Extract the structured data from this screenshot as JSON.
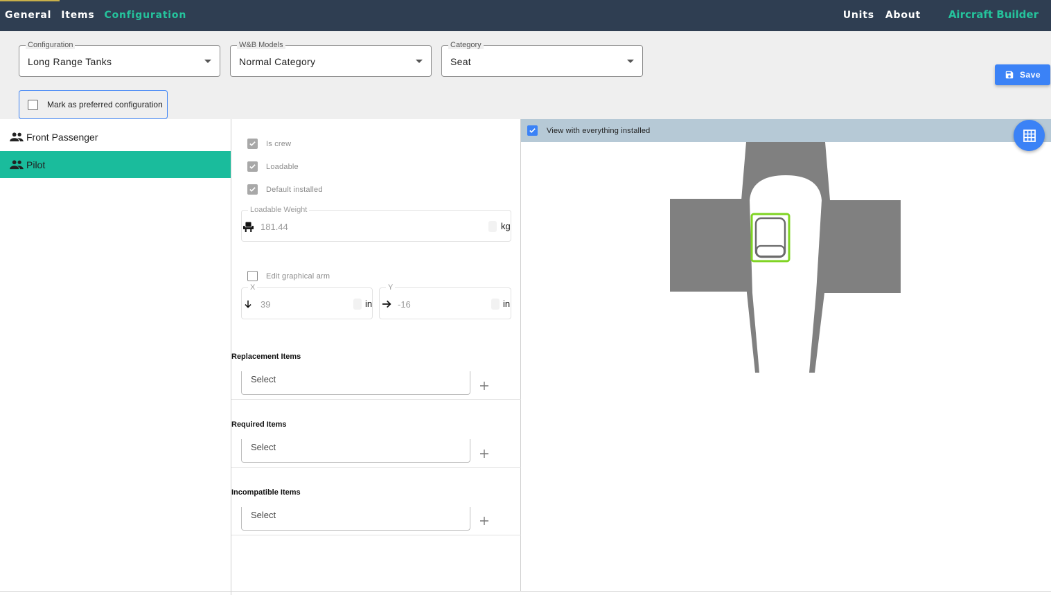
{
  "nav": {
    "left": [
      "General",
      "Items",
      "Configuration"
    ],
    "right": [
      "Units",
      "About"
    ],
    "brand": "Aircraft Builder"
  },
  "config": {
    "configuration": {
      "legend": "Configuration",
      "value": "Long Range Tanks"
    },
    "models": {
      "legend": "W&B Models",
      "value": "Normal Category"
    },
    "category": {
      "legend": "Category",
      "value": "Seat"
    },
    "preferred_label": "Mark as preferred configuration",
    "save_label": "Save"
  },
  "items": [
    {
      "label": "Front Passenger",
      "icon": "people-icon"
    },
    {
      "label": "Pilot",
      "icon": "people-icon",
      "selected": true
    }
  ],
  "form": {
    "is_crew": "Is crew",
    "loadable": "Loadable",
    "default_installed": "Default installed",
    "weight": {
      "legend": "Loadable Weight",
      "value": "181.44",
      "unit": "kg"
    },
    "edit_arm": "Edit graphical arm",
    "x": {
      "legend": "X",
      "value": "39",
      "unit": "in"
    },
    "y": {
      "legend": "Y",
      "value": "-16",
      "unit": "in"
    },
    "replacement": {
      "title": "Replacement Items",
      "placeholder": "Select"
    },
    "required": {
      "title": "Required Items",
      "placeholder": "Select"
    },
    "incompatible": {
      "title": "Incompatible Items",
      "placeholder": "Select"
    }
  },
  "preview": {
    "view_label": "View with everything installed"
  },
  "colors": {
    "topbar": "#2f3e52",
    "accent": "#25c39c",
    "primary": "#3b82f6",
    "selected_row": "#1abc9c",
    "fuselage": "#808080",
    "seat_highlight": "#7ed321"
  }
}
